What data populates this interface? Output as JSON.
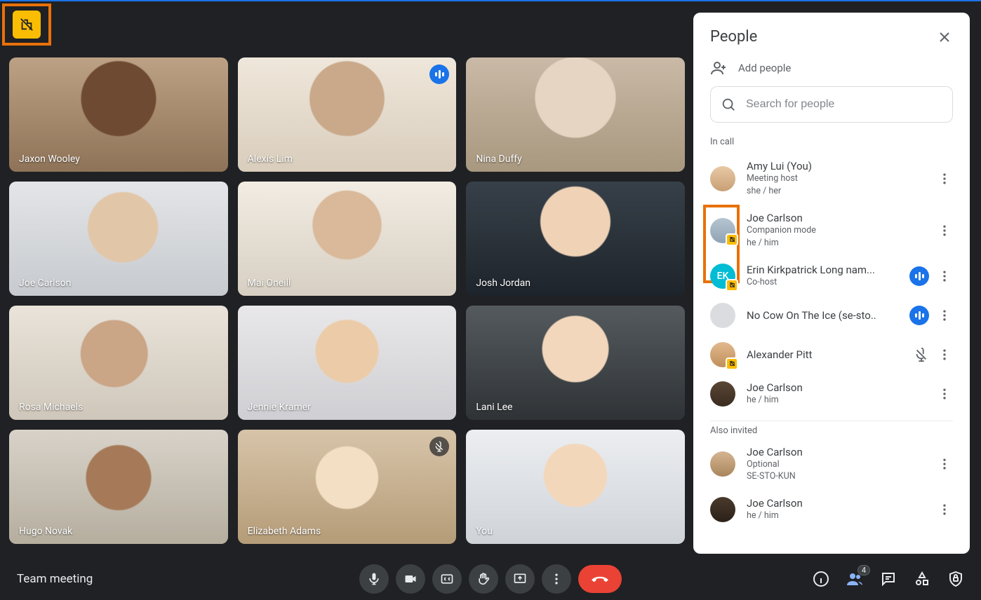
{
  "meeting": {
    "title": "Team meeting",
    "participants_badge": "4"
  },
  "tiles": [
    {
      "name": "Jaxon Wooley"
    },
    {
      "name": "Alexis Lim",
      "speaking": true
    },
    {
      "name": "Nina Duffy"
    },
    {
      "name": "Joe Carlson"
    },
    {
      "name": "Mai Oneill"
    },
    {
      "name": "Josh Jordan"
    },
    {
      "name": "Rosa Michaels"
    },
    {
      "name": "Jennie Kramer"
    },
    {
      "name": "Lani Lee"
    },
    {
      "name": "Hugo Novak"
    },
    {
      "name": "Elizabeth Adams",
      "muted": true
    },
    {
      "name": "You"
    }
  ],
  "panel": {
    "title": "People",
    "add_label": "Add people",
    "search_placeholder": "Search for people",
    "section_in_call": "In call",
    "section_also_invited": "Also invited",
    "in_call": [
      {
        "name": "Amy Lui (You)",
        "line2": "Meeting host",
        "line3": "she / her"
      },
      {
        "name": "Joe Carlson",
        "line2": "Companion mode",
        "line3": "he / him",
        "companion": true
      },
      {
        "name": "Erin Kirkpatrick Long nam...",
        "line2": "Co-host",
        "initials": "EK",
        "companion": true,
        "speaking": true
      },
      {
        "name": "No Cow On The Ice (se-sto..",
        "speaking": true
      },
      {
        "name": "Alexander Pitt",
        "muted": true,
        "companion": true
      },
      {
        "name": "Joe Carlson",
        "line2": "he / him"
      }
    ],
    "also_invited": [
      {
        "name": "Joe Carlson",
        "line2": "Optional",
        "line3": "SE-STO-KUN"
      },
      {
        "name": "Joe Carlson",
        "line2": "he / him"
      }
    ]
  },
  "icons": {
    "companion": "domain-disabled-icon"
  }
}
